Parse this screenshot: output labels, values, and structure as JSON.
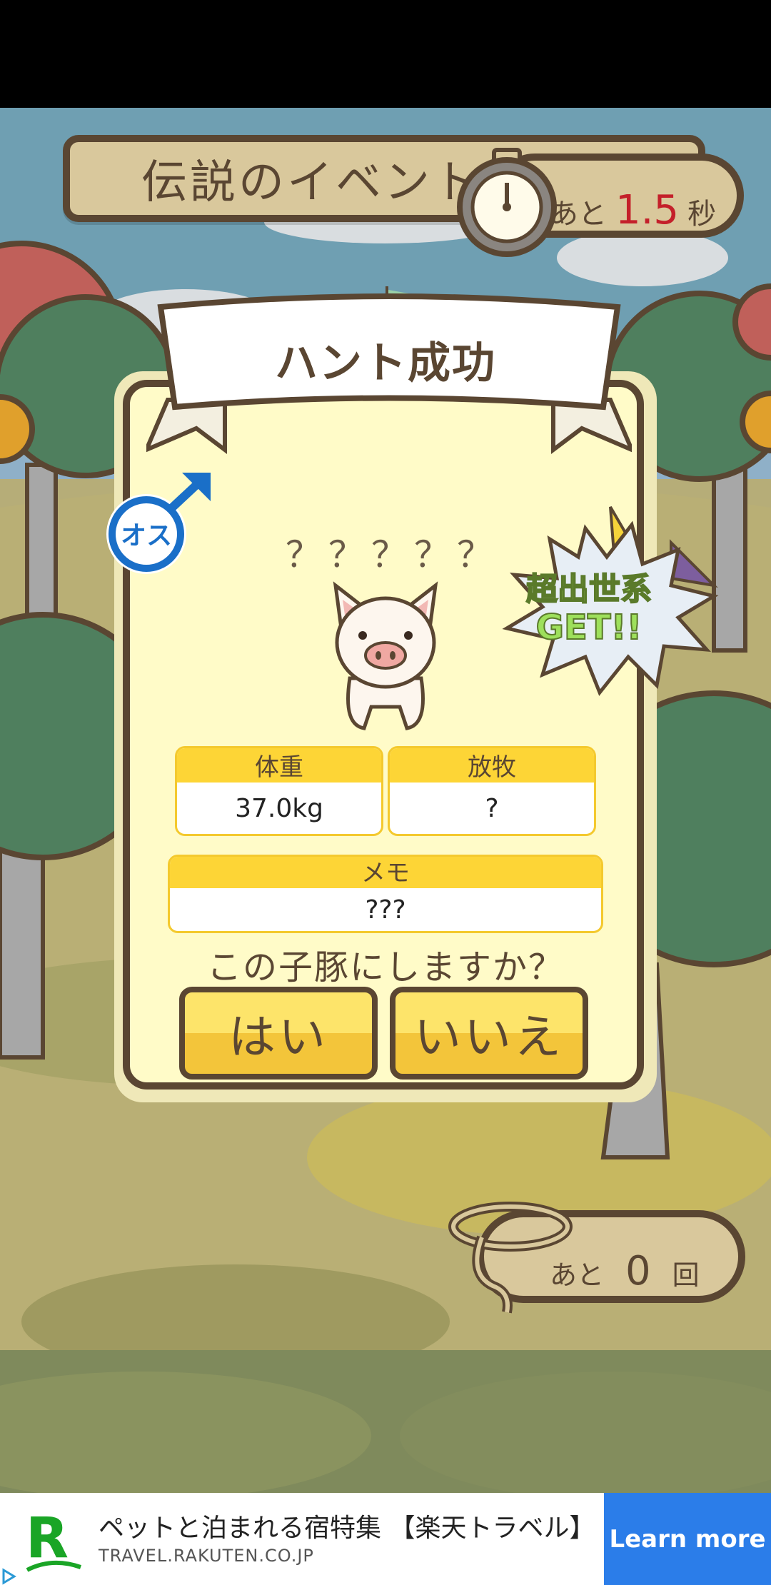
{
  "header": {
    "title": "伝説のイベントハント"
  },
  "timer": {
    "prefix": "あと",
    "value": "1.5",
    "unit": "秒",
    "icon": "stopwatch-icon"
  },
  "result": {
    "ribbon_title": "ハント成功",
    "gender_label": "オス",
    "badge_line1": "超出世系",
    "badge_line2": "GET!!",
    "pig_name": "？？？？？",
    "weight": {
      "label": "体重",
      "value": "37.0kg"
    },
    "grazing": {
      "label": "放牧",
      "value": "?"
    },
    "memo": {
      "label": "メモ",
      "value": "???"
    },
    "question": "この子豚にしますか？",
    "yes_label": "はい",
    "no_label": "いいえ"
  },
  "attempts": {
    "prefix": "あと",
    "value": "0",
    "unit": "回",
    "icon": "lasso-rope-icon"
  },
  "ad": {
    "logo_letter": "R",
    "title": "ペットと泊まれる宿特集 【楽天トラベル】",
    "url": "TRAVEL.RAKUTEN.CO.JP",
    "cta": "Learn more"
  },
  "colors": {
    "accent_red": "#c4202a",
    "wood": "#d9c89c",
    "outline": "#5a4632",
    "button_yellow": "#fde46a",
    "ad_blue": "#2b7de9"
  }
}
